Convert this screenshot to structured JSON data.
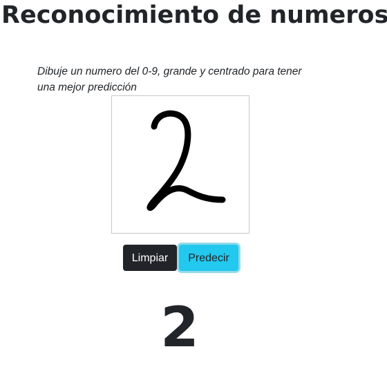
{
  "page": {
    "title": "Reconocimiento de numeros",
    "instructions": "Dibuje un numero del 0-9, grande y centrado para tener una mejor predicción"
  },
  "canvas": {
    "drawn_digit_description_icon": "handwritten-digit-stroke",
    "stroke_color": "#000000"
  },
  "buttons": {
    "clear_label": "Limpiar",
    "predict_label": "Predecir"
  },
  "result": {
    "prediction": "2"
  },
  "colors": {
    "dark_button": "#212529",
    "info_button": "#22c8ee",
    "text": "#212529"
  }
}
